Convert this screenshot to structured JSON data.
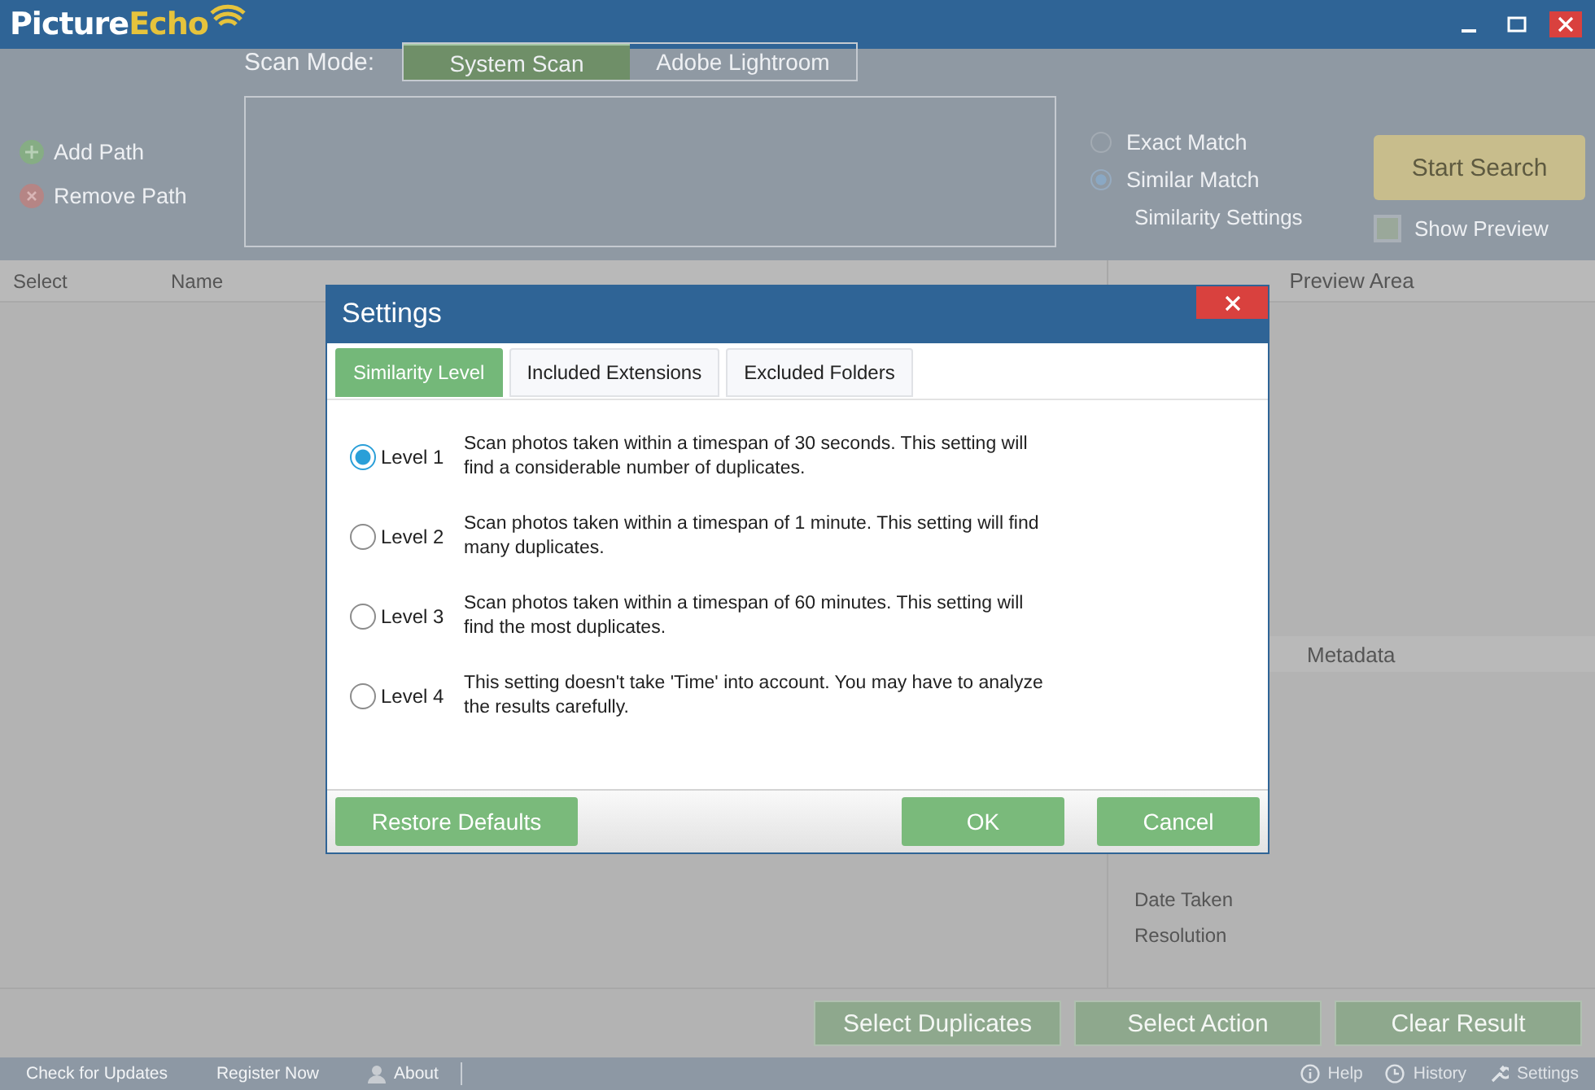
{
  "app": {
    "logo": [
      "Picture",
      "Echo"
    ]
  },
  "scan_mode": {
    "label": "Scan Mode:",
    "tabs": [
      {
        "label": "System Scan",
        "selected": true
      },
      {
        "label": "Adobe Lightroom",
        "selected": false
      }
    ]
  },
  "path_actions": [
    {
      "kind": "add",
      "label": "Add Path"
    },
    {
      "kind": "remove",
      "label": "Remove Path"
    }
  ],
  "match_options": [
    {
      "label": "Exact Match",
      "selected": false
    },
    {
      "label": "Similar Match",
      "selected": true
    }
  ],
  "similarity_settings": "Similarity Settings",
  "start_search": "Start Search",
  "show_preview": {
    "label": "Show Preview",
    "checked": false
  },
  "table": {
    "columns": [
      "Select",
      "Name"
    ]
  },
  "preview_area": {
    "title": "Preview Area"
  },
  "metadata": {
    "title": "Metadata",
    "fields": [
      "Date Taken",
      "Resolution"
    ]
  },
  "bottom_buttons": [
    "Select Duplicates",
    "Select Action",
    "Clear Result"
  ],
  "status_bar": {
    "left": [
      {
        "kind": "link",
        "label": "Check for Updates"
      },
      {
        "kind": "link",
        "label": "Register Now"
      },
      {
        "kind": "user",
        "label": "About"
      }
    ],
    "right": [
      {
        "kind": "help",
        "label": "Help"
      },
      {
        "kind": "history",
        "label": "History"
      },
      {
        "kind": "settings",
        "label": "Settings"
      }
    ]
  },
  "dialog": {
    "title": "Settings",
    "tabs": [
      {
        "label": "Similarity Level",
        "selected": true
      },
      {
        "label": "Included Extensions",
        "selected": false
      },
      {
        "label": "Excluded Folders",
        "selected": false
      }
    ],
    "levels": [
      {
        "label": "Level 1",
        "description": "Scan photos taken within a timespan of 30 seconds. This setting will find a considerable number of duplicates.",
        "selected": true
      },
      {
        "label": "Level 2",
        "description": "Scan photos taken within a timespan of 1 minute. This setting will find many duplicates.",
        "selected": false
      },
      {
        "label": "Level 3",
        "description": "Scan photos taken within a timespan of 60 minutes. This setting will find the most duplicates.",
        "selected": false
      },
      {
        "label": "Level 4",
        "description": "This setting doesn't take 'Time' into account. You may have to analyze the results carefully.",
        "selected": false
      }
    ],
    "buttons": {
      "restore": "Restore Defaults",
      "ok": "OK",
      "cancel": "Cancel"
    }
  }
}
